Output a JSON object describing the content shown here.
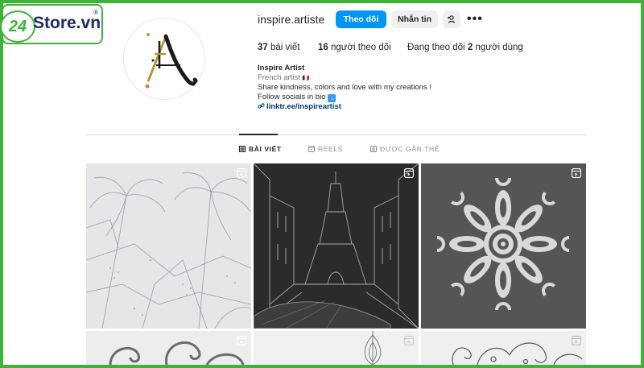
{
  "watermark": {
    "badge": "24",
    "brand": "Store.vn",
    "reg": "®"
  },
  "profile": {
    "username": "inspire.artiste",
    "follow_label": "Theo dõi",
    "message_label": "Nhắn tin",
    "more_label": "•••",
    "stats": {
      "posts_count": "37",
      "posts_label": "bài viết",
      "followers_count": "16",
      "followers_label": "người theo dõi",
      "following_prefix": "Đang theo dõi",
      "following_count": "2",
      "following_label": "người dùng"
    },
    "bio": {
      "name": "Inspire Artist",
      "category": "French artist",
      "category_flag": "🇫🇷",
      "line": "Share kindness, colors and love with my creations !",
      "follow_text": "Follow socials in bio",
      "link": "linktr.ee/inspireartist"
    }
  },
  "tabs": [
    {
      "label": "BÀI VIẾT",
      "icon": "grid-icon",
      "active": true
    },
    {
      "label": "REELS",
      "icon": "reels-icon",
      "active": false
    },
    {
      "label": "ĐƯỢC GẮN THẺ",
      "icon": "tagged-icon",
      "active": false
    }
  ],
  "posts": [
    {
      "subject": "palm-trees-coloring",
      "type": "reel"
    },
    {
      "subject": "eiffel-tower-street",
      "type": "reel"
    },
    {
      "subject": "mandala",
      "type": "reel"
    },
    {
      "subject": "swirls",
      "type": "reel"
    },
    {
      "subject": "peacock-feather",
      "type": "reel"
    },
    {
      "subject": "paisley",
      "type": "reel"
    }
  ],
  "colors": {
    "accent": "#0095f6",
    "frame": "#3fb23a",
    "brand_text": "#1c2b6b"
  }
}
